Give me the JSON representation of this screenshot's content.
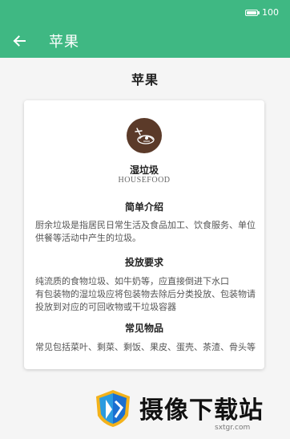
{
  "status_bar": {
    "battery_level": "100"
  },
  "app_bar": {
    "back_icon": "arrow-left-icon",
    "title": "苹果"
  },
  "page": {
    "heading": "苹果"
  },
  "category": {
    "icon": "wet-garbage-icon",
    "icon_color": "#5b3a29",
    "name": "湿垃圾",
    "name_en": "HOUSEFOOD"
  },
  "sections": {
    "intro": {
      "title": "简单介绍",
      "body": "厨余垃圾是指居民日常生活及食品加工、饮食服务、单位供餐等活动中产生的垃圾。"
    },
    "requirements": {
      "title": "投放要求",
      "line1": "纯流质的食物垃圾、如牛奶等，应直接倒进下水口",
      "line2": "有包装物的湿垃圾应将包装物去除后分类投放、包装物请投放到对应的可回收物或干垃圾容器"
    },
    "common": {
      "title": "常见物品",
      "body": "常见包括菜叶、剩菜、剩饭、果皮、蛋壳、茶渣、骨头等"
    }
  },
  "watermark": {
    "text": "摄像下载站",
    "url": "sxtgr.com"
  },
  "colors": {
    "primary": "#3fb883",
    "background": "#f5f5f5",
    "card": "#ffffff"
  }
}
